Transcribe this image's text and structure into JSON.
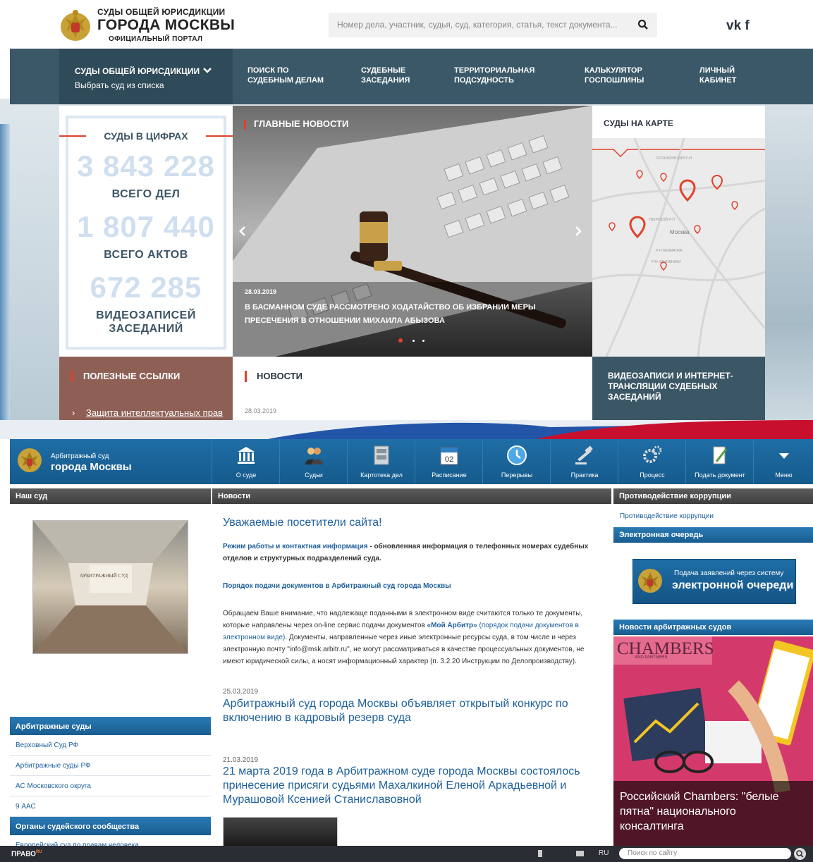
{
  "top_site": {
    "header": {
      "logo_line1": "СУДЫ ОБЩЕЙ ЮРИСДИКЦИИ",
      "logo_line2": "ГОРОДА МОСКВЫ",
      "logo_line3": "ОФИЦИАЛЬНЫЙ ПОРТАЛ",
      "search_placeholder": "Номер дела, участник, судья, суд, категория, статья, текст документа...",
      "social": "vk f"
    },
    "nav": {
      "courts_title": "СУДЫ ОБЩЕЙ ЮРИСДИКЦИИ",
      "courts_sub": "Выбрать суд из списка",
      "items": [
        {
          "l1": "ПОИСК ПО",
          "l2": "СУДЕБНЫМ ДЕЛАМ"
        },
        {
          "l1": "СУДЕБНЫЕ",
          "l2": "ЗАСЕДАНИЯ"
        },
        {
          "l1": "ТЕРРИТОРИАЛЬНАЯ",
          "l2": "ПОДСУДНОСТЬ"
        },
        {
          "l1": "КАЛЬКУЛЯТОР",
          "l2": "ГОСПОШЛИНЫ"
        },
        {
          "l1": "ЛИЧНЫЙ",
          "l2": "КАБИНЕТ"
        }
      ]
    },
    "stats": {
      "title": "СУДЫ В ЦИФРАХ",
      "cases_num": "3 843 228",
      "cases_lbl": "ВСЕГО ДЕЛ",
      "acts_num": "1 807 440",
      "acts_lbl": "ВСЕГО АКТОВ",
      "video_num": "672 285",
      "video_lbl1": "ВИДЕОЗАПИСЕЙ",
      "video_lbl2": "ЗАСЕДАНИЙ"
    },
    "main_news": {
      "title": "ГЛАВНЫЕ НОВОСТИ",
      "date": "28.03.2019",
      "headline1": "В БАСМАННОМ СУДЕ РАССМОТРЕНО ХОДАТАЙСТВО ОБ ИЗБРАНИИ МЕРЫ",
      "headline2": "ПРЕСЕЧЕНИЯ В ОТНОШЕНИИ МИХАИЛА АБЫЗОВА"
    },
    "map": {
      "title": "СУДЫ НА КАРТЕ",
      "city": "Москва",
      "labels": [
        "ОСТАНКИНСКИЙ Р-Н",
        "ТВЕРСКОЙ Р-Н",
        "Р-Н ХАМОВНИКИ",
        "Р-Н ЯКИМАНКА"
      ]
    },
    "links": {
      "title": "ПОЛЕЗНЫЕ ССЫЛКИ",
      "item": "Защита интеллектуальных прав"
    },
    "news": {
      "title": "НОВОСТИ",
      "date": "28.03.2019"
    },
    "video": {
      "line1": "ВИДЕОЗАПИСИ И ИНТЕРНЕТ-",
      "line2": "ТРАНСЛЯЦИИ СУДЕБНЫХ",
      "line3": "ЗАСЕДАНИЙ"
    }
  },
  "bottom_site": {
    "logo_small": "Арбитражный суд",
    "logo_big": "города Москвы",
    "nav": [
      "О суде",
      "Судьи",
      "Картотека дел",
      "Расписание",
      "Перерывы",
      "Практика",
      "Процесс",
      "Подать документ",
      "Меню"
    ],
    "calendar_day": "02",
    "left": {
      "header": "Наш суд",
      "photo_sign": "АРБИТРАЖНЫЙ СУД",
      "arb_header": "Арбитражные суды",
      "arb_links": [
        "Верховный Суд РФ",
        "Арбитражные суды РФ",
        "АС Московского округа",
        "9 ААС"
      ],
      "org_header": "Органы судейского сообщества",
      "org_link": "Европейский суд по правам человека"
    },
    "center": {
      "header": "Новости",
      "welcome": "Уважаемые посетители сайта!",
      "p1_link": "Режим работы и контактная информация",
      "p1_rest": " - обновленная информация о телефонных номерах судебных",
      "p1_line2": "отделов и структурных подразделений суда.",
      "p2_link": "Порядок подачи документов в Арбитражный суд города Москвы",
      "p3_l1a": "Обращаем Ваше внимание, что надлежаще поданными в электронном виде считаются только те документы,",
      "p3_l2a": "которые направлены через on-line сервис подачи документов ",
      "p3_l2b": "«Мой Арбитр»",
      "p3_l2c": " (порядок подачи документов в",
      "p3_l3a": "электронном виде)",
      "p3_l3b": ". Документы, направленные через иные электронные ресурсы суда, в том числе и через",
      "p3_l4": "электронную почту \"info@msk.arbitr.ru\", не могут рассматриваться в качестве процессуальных документов, не",
      "p3_l5": "имеют юридической силы, а носят информационный характер (п. 3.2.20 Инструкции по Делопроизводству).",
      "n1_date": "25.03.2019",
      "n1_t1": "Арбитражный суд города Москвы объявляет открытый конкурс по",
      "n1_t2": "включению в кадровый резерв суда",
      "n2_date": "21.03.2019",
      "n2_t1": "21 марта 2019 года в Арбитражном суде города Москвы состоялось",
      "n2_t2": "принесение присяги судьями Махалкиной Еленой Аркадьевной и",
      "n2_t3": "Мурашовой Ксенией Станиславовной"
    },
    "right": {
      "h1": "Противодействие коррупции",
      "l1": "Противодействие коррупции",
      "h2": "Электронная очередь",
      "banner_small": "Подача заявлений через систему",
      "banner_big": "электронной очереди",
      "h3": "Новости арбитражных судов",
      "chambers": "CHAMBERS",
      "chambers_sub": "AND PARTNERS",
      "caption1": "Российский Chambers: \"белые",
      "caption2": "пятна\" национального",
      "caption3": "консалтинга"
    },
    "footer": {
      "brand": "ПРАВО",
      "brand_sup": "RU",
      "lang": "RU",
      "search_placeholder": "Поиск по сайту"
    }
  },
  "colors": {
    "top_nav": "#3a5868",
    "accent_red": "#e0412b",
    "arb_blue": "#1d5f9a",
    "stats_num": "#cfdfef"
  }
}
